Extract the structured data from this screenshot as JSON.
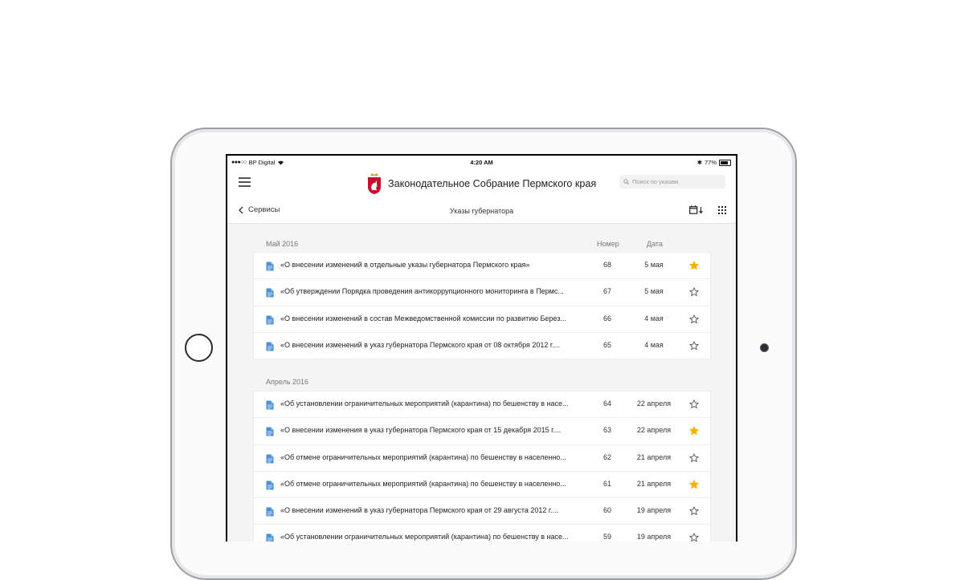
{
  "colors": {
    "accent_star": "#f5b301",
    "doc_icon": "#4a90d9",
    "emblem_red": "#c8102e"
  },
  "status_bar": {
    "carrier": "BP Digital",
    "time": "4:20 AM",
    "battery": "77%"
  },
  "header": {
    "title": "Законодательное Собрание Пермского края",
    "search_placeholder": "Поиск по указам"
  },
  "subnav": {
    "back_label": "Сервисы",
    "page_title": "Указы губернатора"
  },
  "columns": {
    "number": "Номер",
    "date": "Дата"
  },
  "sections": [
    {
      "title": "Май 2016",
      "rows": [
        {
          "title": "«О внесении изменений в отдельные указы губернатора Пермского края»",
          "number": "68",
          "date": "5 мая",
          "starred": true
        },
        {
          "title": "«Об утверждении Порядка проведения антикоррупционного мониторинга в Пермс...",
          "number": "67",
          "date": "5 мая",
          "starred": false
        },
        {
          "title": "«О внесении изменений в состав Межведомственной комиссии по развитию Берез...",
          "number": "66",
          "date": "4 мая",
          "starred": false
        },
        {
          "title": "«О внесении изменений в указ губернатора Пермского края от 08 октября 2012 г....",
          "number": "65",
          "date": "4 мая",
          "starred": false
        }
      ]
    },
    {
      "title": "Апрель 2016",
      "rows": [
        {
          "title": "«Об установлении ограничительных мероприятий (карантина) по бешенству в насе...",
          "number": "64",
          "date": "22 апреля",
          "starred": false
        },
        {
          "title": "«О внесении изменения в указ губернатора Пермского края от 15 декабря 2015 г....",
          "number": "63",
          "date": "22 апреля",
          "starred": true
        },
        {
          "title": "«Об отмене ограничительных мероприятий (карантина) по бешенству в населенно...",
          "number": "62",
          "date": "21 апреля",
          "starred": false
        },
        {
          "title": "«Об отмене ограничительных мероприятий (карантина) по бешенству в населенно...",
          "number": "61",
          "date": "21 апреля",
          "starred": true
        },
        {
          "title": "«О внесении изменений в указ губернатора Пермского края от 29 августа 2012 г....",
          "number": "60",
          "date": "19 апреля",
          "starred": false
        },
        {
          "title": "«Об установлении ограничительных мероприятий (карантина) по бешенству в насе...",
          "number": "59",
          "date": "19 апреля",
          "starred": false
        }
      ]
    }
  ]
}
